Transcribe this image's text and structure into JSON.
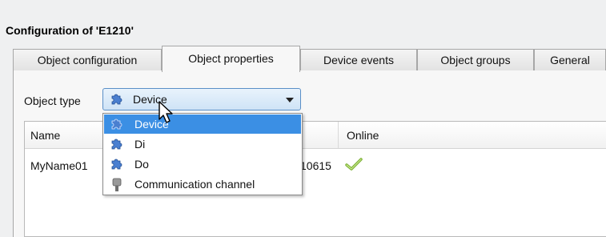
{
  "window": {
    "title": "Configuration of 'E1210'"
  },
  "tabs": [
    {
      "label": "Object configuration"
    },
    {
      "label": "Object properties"
    },
    {
      "label": "Device events"
    },
    {
      "label": "Object groups"
    },
    {
      "label": "General"
    }
  ],
  "active_tab": "Object properties",
  "object_type": {
    "label": "Object type",
    "selected": "Device",
    "icon": "puzzle-icon",
    "options": [
      {
        "label": "Device",
        "icon": "puzzle-icon"
      },
      {
        "label": "Di",
        "icon": "puzzle-icon"
      },
      {
        "label": "Do",
        "icon": "puzzle-icon"
      },
      {
        "label": "Communication channel",
        "icon": "plug-icon"
      }
    ]
  },
  "table": {
    "columns": [
      "Name",
      "Online"
    ],
    "rows": [
      {
        "name": "MyName01",
        "hidden_value": "10615",
        "online": true
      }
    ]
  },
  "colors": {
    "selection": "#3b8fe4",
    "online_check": "#7fb33a",
    "puzzle": "#4a7fd0"
  }
}
